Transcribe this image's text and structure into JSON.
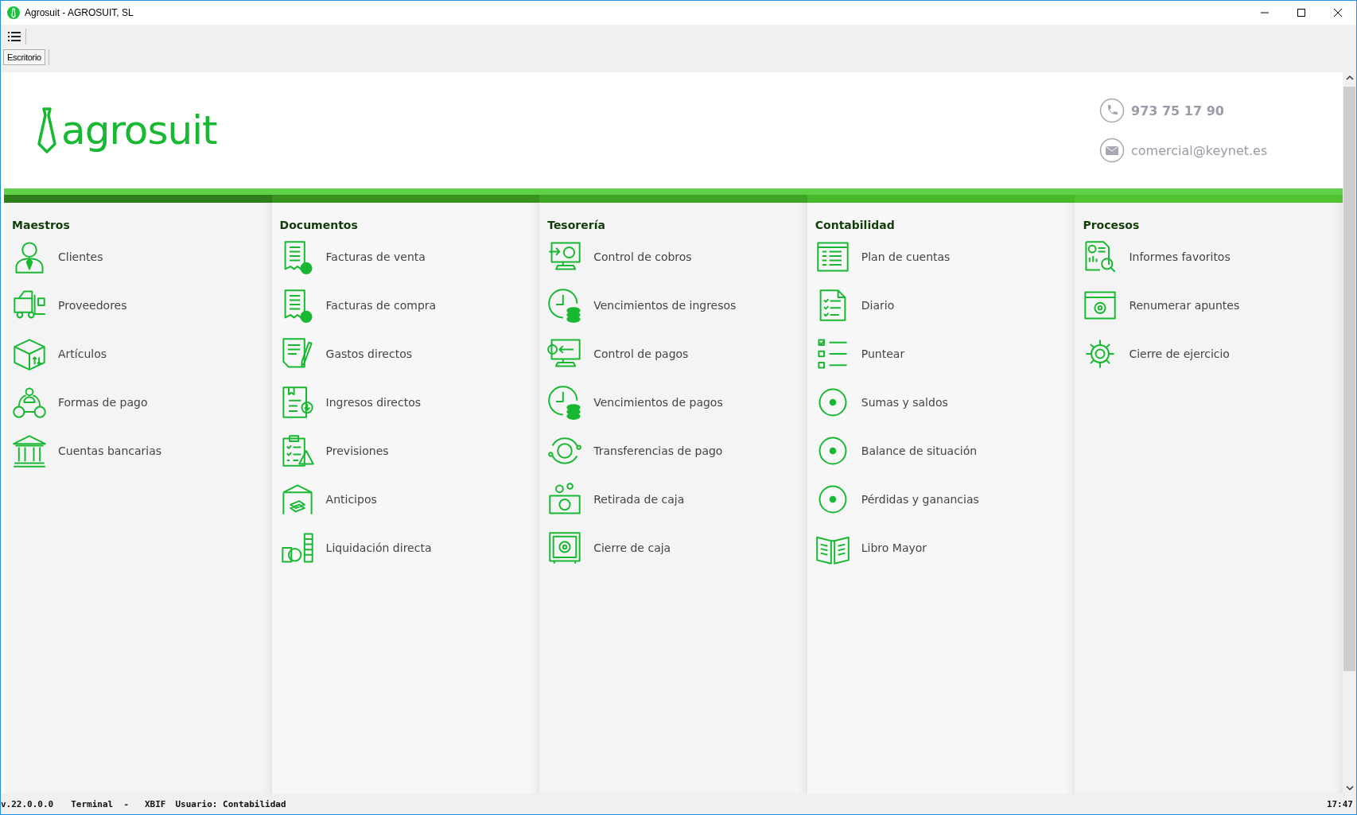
{
  "window": {
    "title": "Agrosuit - AGROSUIT, SL"
  },
  "tabs": [
    {
      "label": "Escritorio",
      "selected": true
    }
  ],
  "header": {
    "logo": "agrosuit",
    "phone": "973 75 17 90",
    "email": "comercial@keynet.es"
  },
  "columns": [
    {
      "title": "Maestros",
      "items": [
        "Clientes",
        "Proveedores",
        "Artículos",
        "Formas de pago",
        "Cuentas bancarias"
      ]
    },
    {
      "title": "Documentos",
      "items": [
        "Facturas de venta",
        "Facturas de compra",
        "Gastos directos",
        "Ingresos directos",
        "Previsiones",
        "Anticipos",
        "Liquidación directa"
      ]
    },
    {
      "title": "Tesorería",
      "items": [
        "Control de cobros",
        "Vencimientos de ingresos",
        "Control de pagos",
        "Vencimientos de pagos",
        "Transferencias de pago",
        "Retirada de caja",
        "Cierre de caja"
      ]
    },
    {
      "title": "Contabilidad",
      "items": [
        "Plan de cuentas",
        "Diario",
        "Puntear",
        "Sumas y saldos",
        "Balance de situación",
        "Pérdidas y ganancias",
        "Libro Mayor"
      ]
    },
    {
      "title": "Procesos",
      "items": [
        "Informes favoritos",
        "Renumerar apuntes",
        "Cierre de ejercicio"
      ]
    }
  ],
  "status_bar": {
    "version": "v.22.0.0.0",
    "terminal": "Terminal  -   XBIF",
    "user": "Usuario: Contabilidad",
    "time": "17:47"
  }
}
